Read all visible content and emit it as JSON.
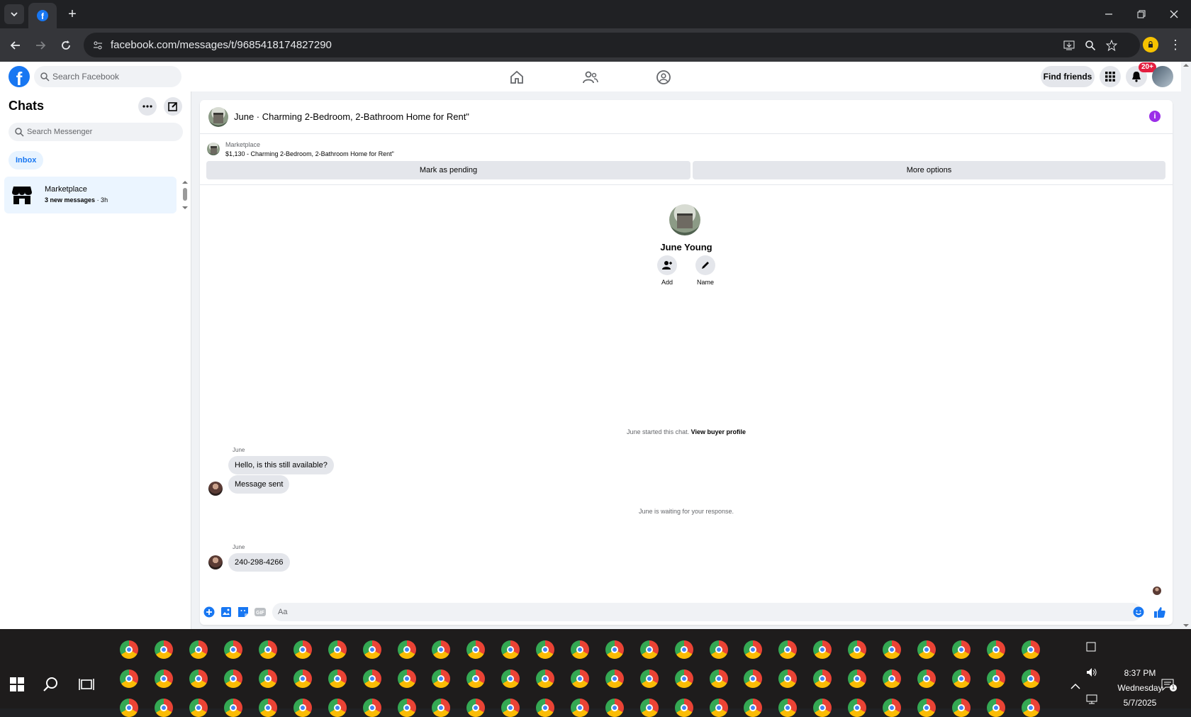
{
  "browser": {
    "url": "facebook.com/messages/t/9685418174827290",
    "new_tab_symbol": "+",
    "menu_symbol": "⋮"
  },
  "fb_nav": {
    "search_placeholder": "Search Facebook",
    "find_friends": "Find friends",
    "notification_badge": "20+"
  },
  "sidebar": {
    "title": "Chats",
    "search_placeholder": "Search Messenger",
    "filter": "Inbox",
    "conversations": [
      {
        "name": "Marketplace",
        "status": "3 new messages",
        "time": "· 3h"
      }
    ]
  },
  "chat": {
    "title": "June · Charming 2-Bedroom, 2-Bathroom Home for Rent\"",
    "marketplace_label": "Marketplace",
    "listing": "$1,130 - Charming 2-Bedroom, 2-Bathroom Home for Rent\"",
    "mark_pending": "Mark as pending",
    "more_options": "More options",
    "profile_name": "June Young",
    "add_label": "Add",
    "name_label": "Name",
    "started_text": "June started this chat.",
    "view_buyer": "View buyer profile",
    "messages": [
      {
        "sender": "June",
        "text": "Hello, is this still available?"
      },
      {
        "text": "Message sent"
      }
    ],
    "waiting_text": "June is waiting for your response.",
    "messages2": [
      {
        "sender": "June",
        "text": "240-298-4266"
      }
    ],
    "composer_placeholder": "Aa"
  },
  "taskbar": {
    "time": "8:37 PM",
    "day": "Wednesday",
    "date": "5/7/2025",
    "notification_count": "1"
  },
  "colors": {
    "fb_blue": "#1877f2",
    "chrome_dark": "#202124",
    "chrome_toolbar": "#35363a",
    "badge_red": "#e41e3f",
    "info_purple": "#9b2ee8"
  }
}
